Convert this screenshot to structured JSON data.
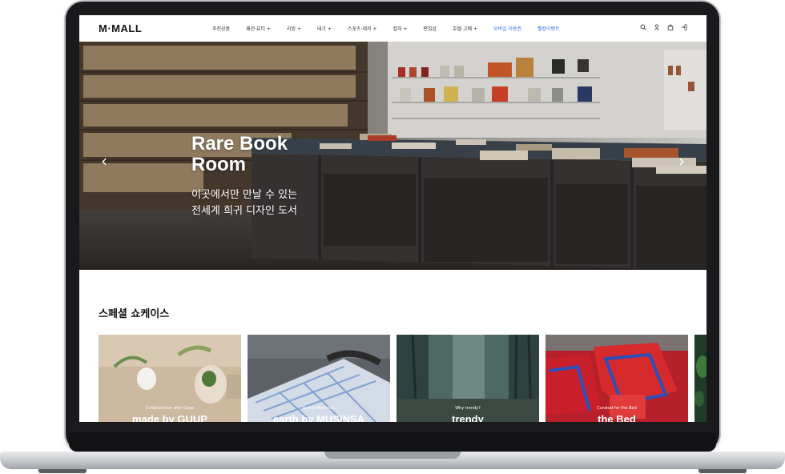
{
  "header": {
    "logo": "M·MALL",
    "nav": [
      "추천상품",
      "패션·뷰티 +",
      "리빙 +",
      "테크 +",
      "스포츠·레저 +",
      "컬처 +",
      "편집샵",
      "호텔·고메 +",
      "모바일 이용권",
      "웰컴이벤트"
    ]
  },
  "hero": {
    "title": "Rare Book Room",
    "subtitle_line1": "이곳에서만 만날 수 있는",
    "subtitle_line2": "전세계 희귀 디자인 도서"
  },
  "showcase": {
    "title": "스페셜 쇼케이스",
    "cards": [
      {
        "small": "Collaboration with Guup",
        "big": "made by GUUP"
      },
      {
        "small": "Better Materials",
        "big": "earth by MUSINSA"
      },
      {
        "small": "Why trendy?",
        "big": "trendy"
      },
      {
        "small": "Curated for the Bed",
        "big": "the Bed"
      }
    ]
  },
  "colors": {
    "accent": "#2f6fe4",
    "text": "#111111"
  },
  "icons": [
    "search-icon",
    "user-icon",
    "bag-icon",
    "login-icon",
    "chevron-left-icon",
    "chevron-right-icon"
  ]
}
